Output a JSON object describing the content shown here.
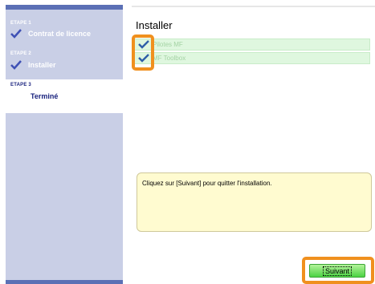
{
  "sidebar": {
    "steps": [
      {
        "number": "ETAPE 1",
        "label": "Contrat de licence",
        "done": true
      },
      {
        "number": "ETAPE 2",
        "label": "Installer",
        "done": true
      },
      {
        "number": "ETAPE 3",
        "label": "Terminé",
        "current": true
      }
    ]
  },
  "main": {
    "title": "Installer",
    "items": [
      {
        "label": "Pilotes MF",
        "checked": true
      },
      {
        "label": "MF Toolbox",
        "checked": true
      }
    ],
    "message": "Cliquez sur [Suivant] pour quitter l'installation.",
    "next_label": "Suivant"
  },
  "colors": {
    "sidebar_bg": "#c9cfe6",
    "sidebar_accent": "#5b70b5",
    "item_bg": "#dff7df",
    "message_bg": "#fffbd0",
    "button_green": "#4cd243",
    "highlight_orange": "#f0901e"
  },
  "icons": {
    "step_done": "checkmark-icon",
    "item_checked": "checkmark-icon"
  }
}
